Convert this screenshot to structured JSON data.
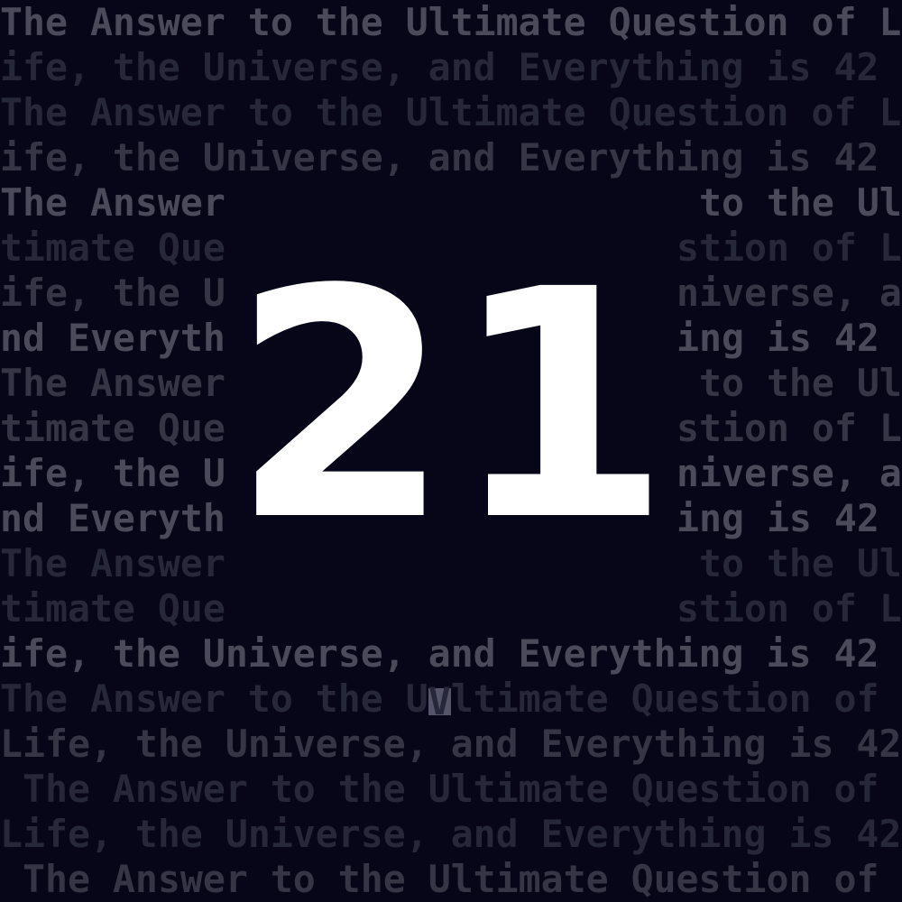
{
  "countdown": "21",
  "colors": {
    "background": "#060618",
    "text_bright": "#4a4a5a",
    "text_medium": "#353545",
    "text_dim": "#27273a",
    "countdown": "#ffffff",
    "cursor": "#55556a"
  },
  "rows": [
    {
      "left": "The Answer to the Ultimate Question of L",
      "level": 2
    },
    {
      "left": "ife, the Universe, and Everything is 42",
      "level": 0
    },
    {
      "left": "The Answer to the Ultimate Question of L",
      "level": 0
    },
    {
      "left": "ife, the Universe, and Everything is 42",
      "level": 1
    },
    {
      "left": "The Answer",
      "right": " to the Ul",
      "level": 2
    },
    {
      "left": "timate Que",
      "right": "stion of L",
      "level": 0
    },
    {
      "left": "ife, the U",
      "right": "niverse, a",
      "level": 1
    },
    {
      "left": "nd Everyth",
      "right": "ing is 42",
      "level": 2
    },
    {
      "left": "The Answer",
      "right": " to the Ul",
      "level": 1
    },
    {
      "left": "timate Que",
      "right": "stion of L",
      "level": 1
    },
    {
      "left": "ife, the U",
      "right": "niverse, a",
      "level": 2
    },
    {
      "left": "nd Everyth",
      "right": "ing is 42",
      "level": 2
    },
    {
      "left": "The Answer",
      "right": " to the Ul",
      "level": 0
    },
    {
      "left": "timate Que",
      "right": "stion of L",
      "level": 0
    },
    {
      "left": "ife, the Universe, and Everything is 42",
      "level": 2
    },
    {
      "left": "The Answer to the U",
      "cursor": "V",
      "after": "ltimate Question of",
      "level": 0
    },
    {
      "left": "Life, the Universe, and Everything is 42",
      "level": 1
    },
    {
      "left": " The Answer to the Ultimate Question of",
      "level": 0
    },
    {
      "left": "Life, the Universe, and Everything is 42",
      "level": 0
    },
    {
      "left": " The Answer to the Ultimate Question of",
      "level": 1
    }
  ]
}
